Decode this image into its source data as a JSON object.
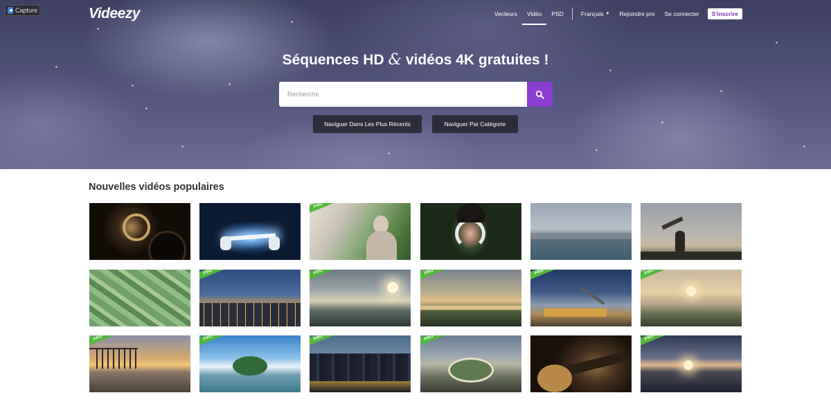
{
  "capture": {
    "label": "Capture"
  },
  "brand": {
    "name": "Videezy"
  },
  "nav": {
    "items": [
      {
        "label": "Vecteurs"
      },
      {
        "label": "Vidéo"
      },
      {
        "label": "PSD"
      }
    ],
    "language": "Français",
    "join_pro": "Rejoindre pro",
    "login": "Se connecter",
    "signup": "S'inscrire"
  },
  "hero": {
    "title_before": "Séquences HD ",
    "title_amp": "&",
    "title_after": " vidéos 4K gratuites !",
    "search_placeholder": "Recherche",
    "browse_recent": "Naviguer Dans Les Plus Récents",
    "browse_category": "Naviguer Par Catégorie"
  },
  "section": {
    "title": "Nouvelles vidéos populaires"
  },
  "thumbs": [
    {
      "pro": false,
      "scene": "vinyl-turntable"
    },
    {
      "pro": false,
      "scene": "tablet-glow-hands"
    },
    {
      "pro": true,
      "scene": "elderly-woman-garden"
    },
    {
      "pro": false,
      "scene": "girl-headphones"
    },
    {
      "pro": false,
      "scene": "coastal-city-aerial"
    },
    {
      "pro": false,
      "scene": "man-with-drone"
    },
    {
      "pro": false,
      "scene": "green-fields-aerial"
    },
    {
      "pro": true,
      "scene": "city-dusk"
    },
    {
      "pro": true,
      "scene": "sunset-wetlands"
    },
    {
      "pro": true,
      "scene": "river-sunset"
    },
    {
      "pro": true,
      "scene": "boat-night-sky"
    },
    {
      "pro": true,
      "scene": "misty-valley-sunrise"
    },
    {
      "pro": true,
      "scene": "beach-pier-sunset"
    },
    {
      "pro": true,
      "scene": "island-tree-lake"
    },
    {
      "pro": true,
      "scene": "city-skyline-night"
    },
    {
      "pro": true,
      "scene": "roundabout-aerial"
    },
    {
      "pro": false,
      "scene": "guitar-player"
    },
    {
      "pro": true,
      "scene": "mountain-sunrise"
    }
  ],
  "pro_label": "PRO",
  "colors": {
    "accent": "#8a3fd0",
    "pro_green": "#52b83a"
  }
}
